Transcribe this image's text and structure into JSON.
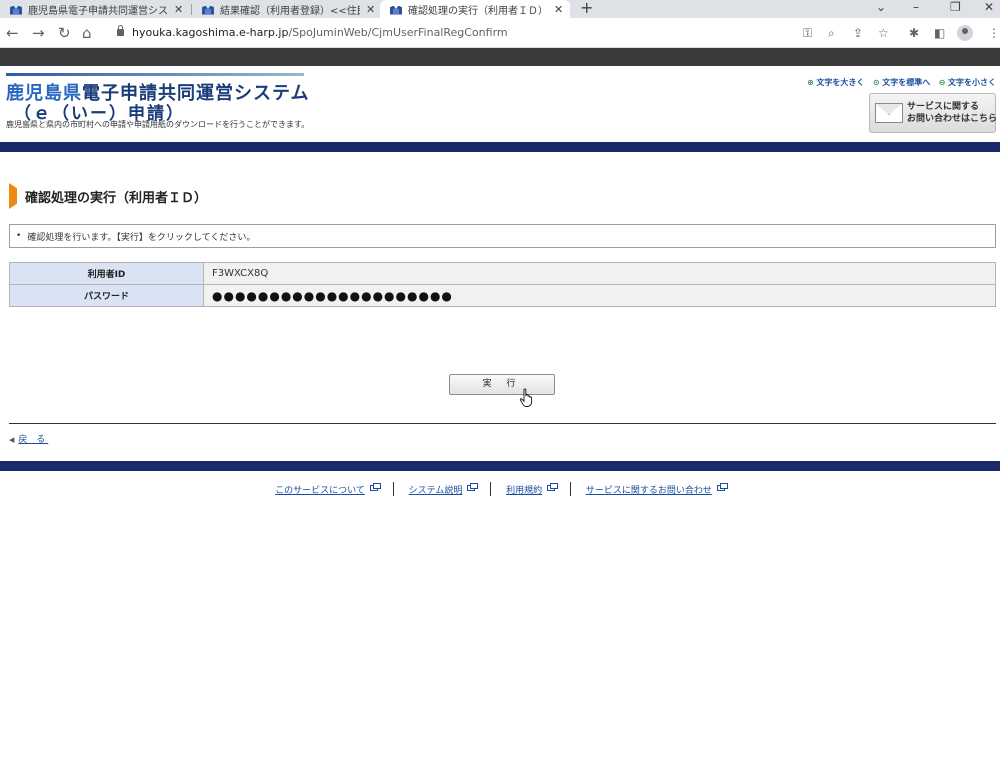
{
  "browser": {
    "tabs": [
      {
        "title": "鹿児島県電子申請共同運営システ",
        "active": false
      },
      {
        "title": "結果確認（利用者登録）<<住民",
        "active": false
      },
      {
        "title": "確認処理の実行（利用者ＩＤ）-",
        "active": true
      }
    ],
    "new_tab": "+",
    "url_host": "hyouka.kagoshima.e-harp.jp",
    "url_path": "/SpoJuminWeb/CjmUserFinalRegConfirm",
    "window_controls": {
      "minimize": "–",
      "restore": "❐",
      "close": "✕",
      "dropdown": "⌄"
    }
  },
  "header": {
    "title_prefix": "鹿児島県",
    "title_main": "電子申請共同運営システム",
    "subtitle": "（ｅ（いー）申請）",
    "description": "鹿児島県と県内の市町村への申請や申請用紙のダウンロードを行うことができます。",
    "font_large": "文字を大きく",
    "font_normal": "文字を標準へ",
    "font_small": "文字を小さく",
    "contact_line1": "サービスに関する",
    "contact_line2": "お問い合わせはこちら"
  },
  "main": {
    "heading": "確認処理の実行（利用者ＩＤ）",
    "notice": "確認処理を行います。【実行】をクリックしてください。",
    "rows": [
      {
        "label": "利用者ID",
        "value": "F3WXCX8Q"
      },
      {
        "label": "パスワード",
        "value": "●●●●●●●●●●●●●●●●●●●●●"
      }
    ],
    "execute_label": "実 行",
    "back_label": "戻 る"
  },
  "footer": {
    "links": [
      "このサービスについて",
      "システム説明",
      "利用規約",
      "サービスに関するお問い合わせ"
    ]
  },
  "colors": {
    "navy_band": "#1b2a6b",
    "heading_marker": "#ee8a14",
    "table_header": "#d9e3f3",
    "link": "#1a4da0"
  }
}
